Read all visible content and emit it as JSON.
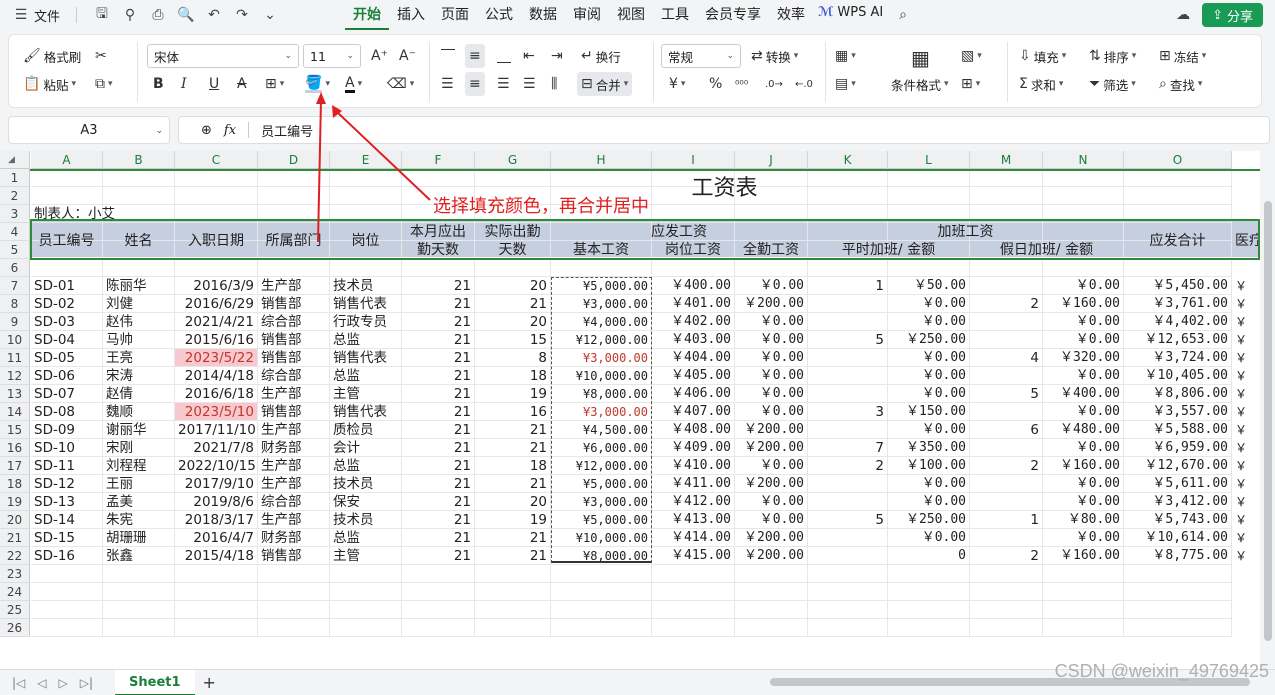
{
  "menubar": {
    "file_label": "文件",
    "tabs": [
      "开始",
      "插入",
      "页面",
      "公式",
      "数据",
      "审阅",
      "视图",
      "工具",
      "会员专享",
      "效率"
    ],
    "active_tab": "开始",
    "wps_ai": "WPS AI",
    "share": "分享"
  },
  "ribbon": {
    "format_painter": "格式刷",
    "paste": "粘贴",
    "font_name": "宋体",
    "font_size": "11",
    "wrap": "换行",
    "number_format": "常规",
    "convert": "转换",
    "merge": "合并",
    "conditional_format": "条件格式",
    "fill": "填充",
    "sort": "排序",
    "freeze": "冻结",
    "sum": "求和",
    "filter": "筛选",
    "find": "查找"
  },
  "formula_bar": {
    "name_box": "A3",
    "fx": "fx",
    "content": "员工编号"
  },
  "grid": {
    "columns": [
      "A",
      "B",
      "C",
      "D",
      "E",
      "F",
      "G",
      "H",
      "I",
      "J",
      "K",
      "L",
      "M",
      "N",
      "O"
    ],
    "rows": [
      "1",
      "2",
      "3",
      "4",
      "5",
      "6",
      "7",
      "8",
      "9",
      "10",
      "11",
      "12",
      "13",
      "14",
      "15",
      "16",
      "17",
      "18",
      "19",
      "20",
      "21",
      "22",
      "23",
      "24",
      "25",
      "26"
    ],
    "title": "工资表",
    "made_by": "制表人：小艾",
    "headers": {
      "emp_id": "员工编号",
      "name": "姓名",
      "hire_date": "入职日期",
      "dept": "所属部门",
      "post": "岗位",
      "due_days": "本月应出勤天数",
      "actual_days": "实际出勤天数",
      "payable": "应发工资",
      "base": "基本工资",
      "post_wage": "岗位工资",
      "full_att": "全勤工资",
      "overtime": "加班工资",
      "ot_normal": "平时加班/ 金额",
      "ot_holiday": "假日加班/ 金额",
      "total": "应发合计",
      "medical": "医疗"
    },
    "records": [
      {
        "id": "SD-01",
        "name": "陈丽华",
        "date": "2016/3/9",
        "dept": "生产部",
        "post": "技术员",
        "due": "21",
        "act": "20",
        "base": "¥5,000.00",
        "pw": "￥400.00",
        "fa": "￥0.00",
        "k": "1",
        "l": "￥50.00",
        "m": "",
        "n": "￥0.00",
        "o": "￥5,450.00"
      },
      {
        "id": "SD-02",
        "name": "刘健",
        "date": "2016/6/29",
        "dept": "销售部",
        "post": "销售代表",
        "due": "21",
        "act": "21",
        "base": "¥3,000.00",
        "pw": "￥401.00",
        "fa": "￥200.00",
        "k": "",
        "l": "￥0.00",
        "m": "2",
        "n": "￥160.00",
        "o": "￥3,761.00"
      },
      {
        "id": "SD-03",
        "name": "赵伟",
        "date": "2021/4/21",
        "dept": "综合部",
        "post": "行政专员",
        "due": "21",
        "act": "20",
        "base": "¥4,000.00",
        "pw": "￥402.00",
        "fa": "￥0.00",
        "k": "",
        "l": "￥0.00",
        "m": "",
        "n": "￥0.00",
        "o": "￥4,402.00"
      },
      {
        "id": "SD-04",
        "name": "马帅",
        "date": "2015/6/16",
        "dept": "销售部",
        "post": "总监",
        "due": "21",
        "act": "15",
        "base": "¥12,000.00",
        "pw": "￥403.00",
        "fa": "￥0.00",
        "k": "5",
        "l": "￥250.00",
        "m": "",
        "n": "￥0.00",
        "o": "￥12,653.00"
      },
      {
        "id": "SD-05",
        "name": "王亮",
        "date": "2023/5/22",
        "dept": "销售部",
        "post": "销售代表",
        "due": "21",
        "act": "8",
        "base": "¥3,000.00",
        "pw": "￥404.00",
        "fa": "￥0.00",
        "k": "",
        "l": "￥0.00",
        "m": "4",
        "n": "￥320.00",
        "o": "￥3,724.00"
      },
      {
        "id": "SD-06",
        "name": "宋涛",
        "date": "2014/4/18",
        "dept": "综合部",
        "post": "总监",
        "due": "21",
        "act": "18",
        "base": "¥10,000.00",
        "pw": "￥405.00",
        "fa": "￥0.00",
        "k": "",
        "l": "￥0.00",
        "m": "",
        "n": "￥0.00",
        "o": "￥10,405.00"
      },
      {
        "id": "SD-07",
        "name": "赵倩",
        "date": "2016/6/18",
        "dept": "生产部",
        "post": "主管",
        "due": "21",
        "act": "19",
        "base": "¥8,000.00",
        "pw": "￥406.00",
        "fa": "￥0.00",
        "k": "",
        "l": "￥0.00",
        "m": "5",
        "n": "￥400.00",
        "o": "￥8,806.00"
      },
      {
        "id": "SD-08",
        "name": "魏顺",
        "date": "2023/5/10",
        "dept": "销售部",
        "post": "销售代表",
        "due": "21",
        "act": "16",
        "base": "¥3,000.00",
        "pw": "￥407.00",
        "fa": "￥0.00",
        "k": "3",
        "l": "￥150.00",
        "m": "",
        "n": "￥0.00",
        "o": "￥3,557.00"
      },
      {
        "id": "SD-09",
        "name": "谢丽华",
        "date": "2017/11/10",
        "dept": "生产部",
        "post": "质检员",
        "due": "21",
        "act": "21",
        "base": "¥4,500.00",
        "pw": "￥408.00",
        "fa": "￥200.00",
        "k": "",
        "l": "￥0.00",
        "m": "6",
        "n": "￥480.00",
        "o": "￥5,588.00"
      },
      {
        "id": "SD-10",
        "name": "宋刚",
        "date": "2021/7/8",
        "dept": "财务部",
        "post": "会计",
        "due": "21",
        "act": "21",
        "base": "¥6,000.00",
        "pw": "￥409.00",
        "fa": "￥200.00",
        "k": "7",
        "l": "￥350.00",
        "m": "",
        "n": "￥0.00",
        "o": "￥6,959.00"
      },
      {
        "id": "SD-11",
        "name": "刘程程",
        "date": "2022/10/15",
        "dept": "生产部",
        "post": "总监",
        "due": "21",
        "act": "18",
        "base": "¥12,000.00",
        "pw": "￥410.00",
        "fa": "￥0.00",
        "k": "2",
        "l": "￥100.00",
        "m": "2",
        "n": "￥160.00",
        "o": "￥12,670.00"
      },
      {
        "id": "SD-12",
        "name": "王丽",
        "date": "2017/9/10",
        "dept": "生产部",
        "post": "技术员",
        "due": "21",
        "act": "21",
        "base": "¥5,000.00",
        "pw": "￥411.00",
        "fa": "￥200.00",
        "k": "",
        "l": "￥0.00",
        "m": "",
        "n": "￥0.00",
        "o": "￥5,611.00"
      },
      {
        "id": "SD-13",
        "name": "孟美",
        "date": "2019/8/6",
        "dept": "综合部",
        "post": "保安",
        "due": "21",
        "act": "20",
        "base": "¥3,000.00",
        "pw": "￥412.00",
        "fa": "￥0.00",
        "k": "",
        "l": "￥0.00",
        "m": "",
        "n": "￥0.00",
        "o": "￥3,412.00"
      },
      {
        "id": "SD-14",
        "name": "朱宪",
        "date": "2018/3/17",
        "dept": "生产部",
        "post": "技术员",
        "due": "21",
        "act": "19",
        "base": "¥5,000.00",
        "pw": "￥413.00",
        "fa": "￥0.00",
        "k": "5",
        "l": "￥250.00",
        "m": "1",
        "n": "￥80.00",
        "o": "￥5,743.00"
      },
      {
        "id": "SD-15",
        "name": "胡珊珊",
        "date": "2016/4/7",
        "dept": "财务部",
        "post": "总监",
        "due": "21",
        "act": "21",
        "base": "¥10,000.00",
        "pw": "￥414.00",
        "fa": "￥200.00",
        "k": "",
        "l": "￥0.00",
        "m": "",
        "n": "￥0.00",
        "o": "￥10,614.00"
      },
      {
        "id": "SD-16",
        "name": "张鑫",
        "date": "2015/4/18",
        "dept": "销售部",
        "post": "主管",
        "due": "21",
        "act": "21",
        "base": "¥8,000.00",
        "pw": "￥415.00",
        "fa": "￥200.00",
        "k": "",
        "l": "0",
        "m": "2",
        "n": "￥160.00",
        "o": "￥8,775.00"
      }
    ],
    "highlighted_rows": [
      "SD-05",
      "SD-08"
    ],
    "annotation": "选择填充颜色，再合并居中"
  },
  "sheets": {
    "active": "Sheet1",
    "add": "+"
  },
  "watermark": "CSDN @weixin_49769425",
  "colors": {
    "accent": "#1a7f37",
    "header_fill": "#c6cfe0",
    "highlight": "#f8c8cf",
    "annotation": "#e02020"
  }
}
